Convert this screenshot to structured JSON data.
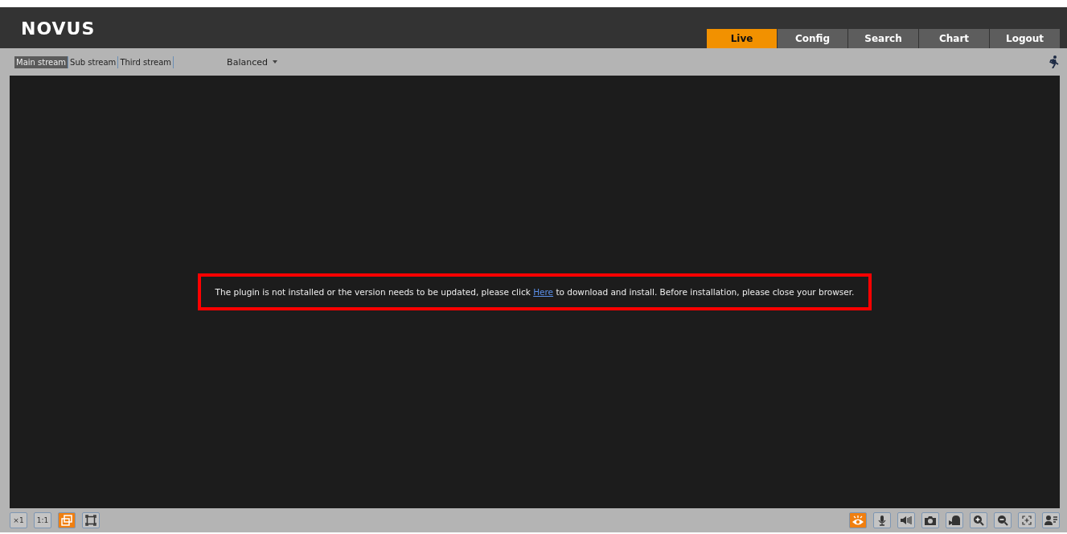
{
  "logo": {
    "text": "NOVUS"
  },
  "nav_tabs": [
    {
      "label": "Live",
      "selected": true
    },
    {
      "label": "Config",
      "selected": false
    },
    {
      "label": "Search",
      "selected": false
    },
    {
      "label": "Chart",
      "selected": false
    },
    {
      "label": "Logout",
      "selected": false
    }
  ],
  "stream_tabs": [
    {
      "label": "Main stream",
      "selected": true
    },
    {
      "label": "Sub stream",
      "selected": false
    },
    {
      "label": "Third stream",
      "selected": false
    }
  ],
  "quality_dropdown": {
    "value": "Balanced"
  },
  "message": {
    "before": "The plugin is not installed or the version needs to be updated, please click ",
    "link": "Here",
    "after": " to download and install. Before installation, please close your browser."
  },
  "left_tools": [
    {
      "kind": "scale",
      "label": "×1",
      "active": false
    },
    {
      "kind": "fit",
      "label": "1:1",
      "active": false
    },
    {
      "kind": "windows",
      "active": true
    },
    {
      "kind": "fullscreen",
      "active": false
    }
  ],
  "right_tools": [
    {
      "kind": "eye",
      "active": true
    },
    {
      "kind": "mic",
      "active": false
    },
    {
      "kind": "speaker",
      "active": false
    },
    {
      "kind": "camera",
      "active": false
    },
    {
      "kind": "record",
      "active": false
    },
    {
      "kind": "zoom-in",
      "active": false
    },
    {
      "kind": "zoom-out",
      "active": false
    },
    {
      "kind": "focus",
      "active": false
    },
    {
      "kind": "person",
      "active": false
    }
  ]
}
